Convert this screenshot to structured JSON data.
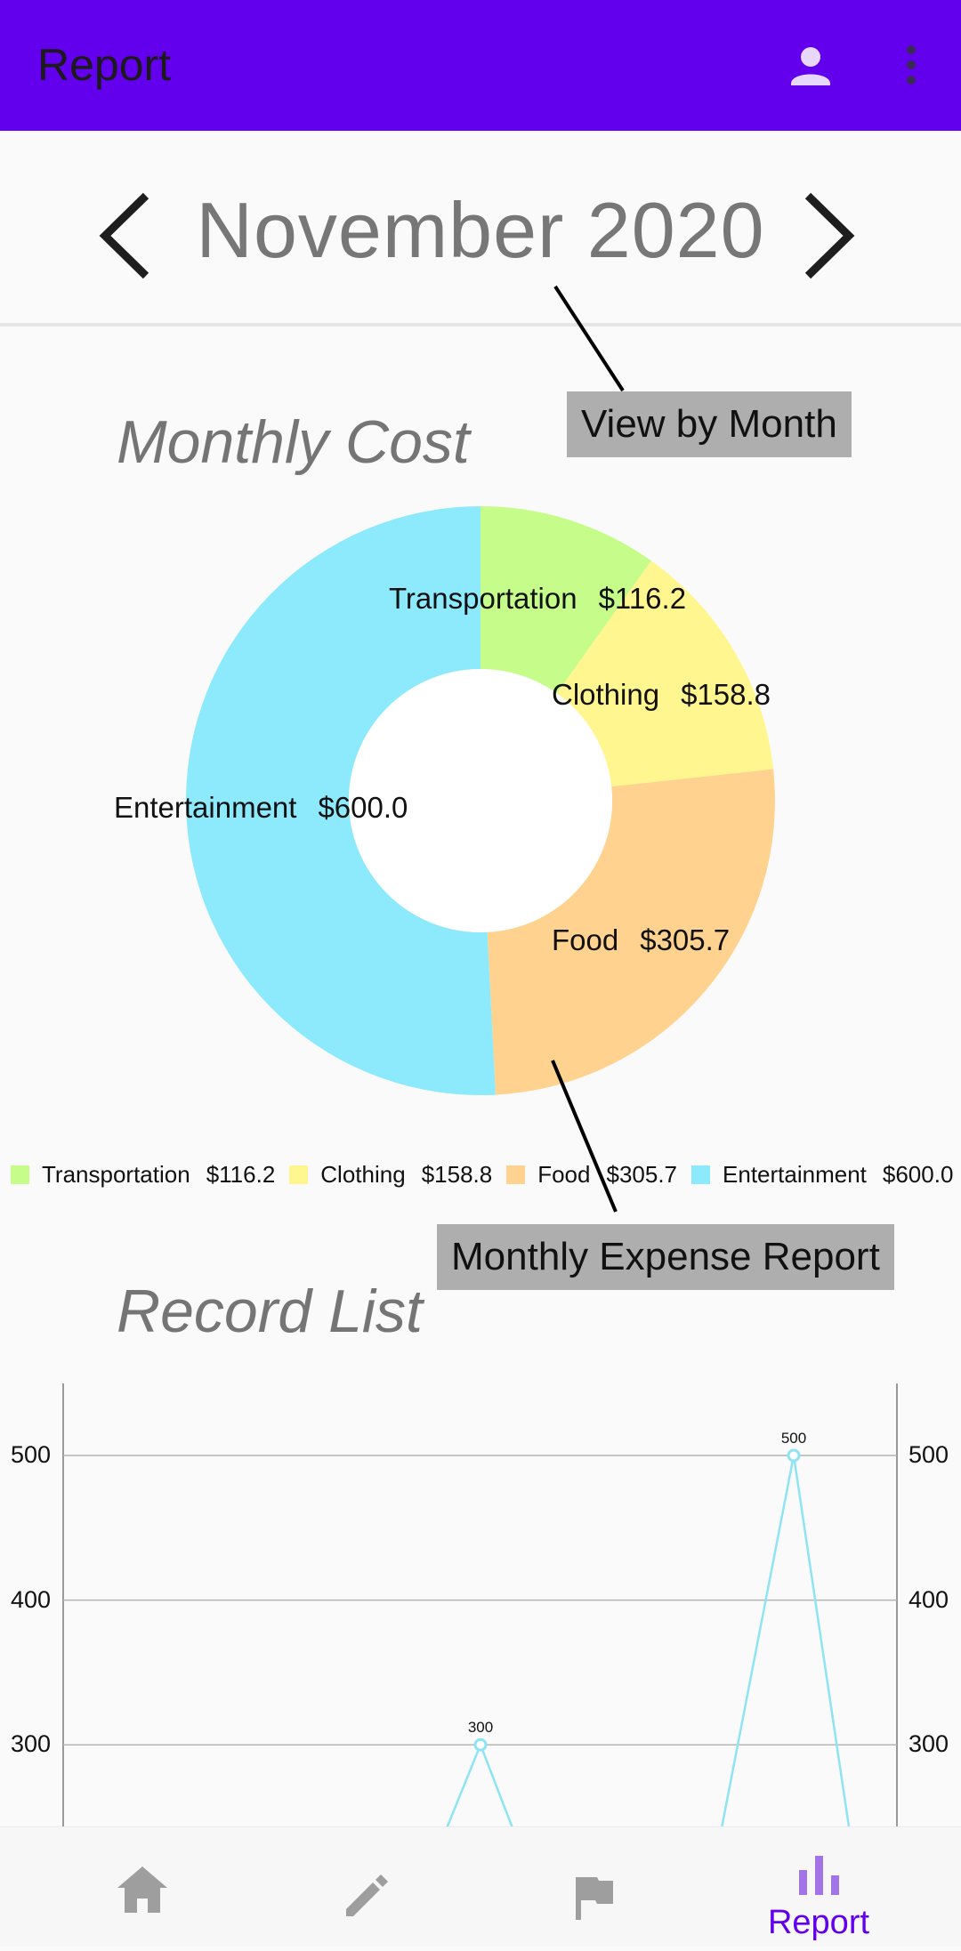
{
  "app_bar": {
    "title": "Report",
    "background": "#6200ee",
    "icons": [
      "person-icon",
      "more-vert-icon"
    ]
  },
  "month_nav": {
    "label": "November 2020",
    "prev_icon": "chevron-left-icon",
    "next_icon": "chevron-right-icon"
  },
  "annotations": {
    "view_by_month": "View by Month",
    "monthly_expense_report": "Monthly Expense Report"
  },
  "monthly_cost": {
    "title": "Monthly Cost"
  },
  "record_list": {
    "title": "Record List"
  },
  "chart_data": [
    {
      "type": "pie",
      "style": "donut",
      "title": "Monthly Cost",
      "categories": [
        "Transportation",
        "Clothing",
        "Food",
        "Entertainment"
      ],
      "values": [
        116.2,
        158.8,
        305.7,
        600.0
      ],
      "value_labels": [
        "$116.2",
        "$158.8",
        "$305.7",
        "$600.0"
      ],
      "colors": [
        "#c5fc8a",
        "#fff68f",
        "#ffd38f",
        "#8deafd"
      ],
      "legend_position": "bottom"
    },
    {
      "type": "line",
      "title": "Record List",
      "y_ticks": [
        "500",
        "400",
        "300"
      ],
      "yaxis_left_visible": true,
      "yaxis_right_visible": true,
      "grid": true,
      "series": [
        {
          "color": "#8ee4f2",
          "points": [
            {
              "value": 300,
              "label": "300"
            },
            {
              "value": 500,
              "label": "500"
            }
          ]
        }
      ]
    }
  ],
  "bottom_nav": {
    "items": [
      {
        "icon": "home-icon",
        "label": ""
      },
      {
        "icon": "pencil-icon",
        "label": ""
      },
      {
        "icon": "flag-icon",
        "label": ""
      },
      {
        "icon": "bar-chart-icon",
        "label": "Report"
      }
    ],
    "active_color": "#6200ee",
    "inactive_color": "#9e9e9e"
  }
}
